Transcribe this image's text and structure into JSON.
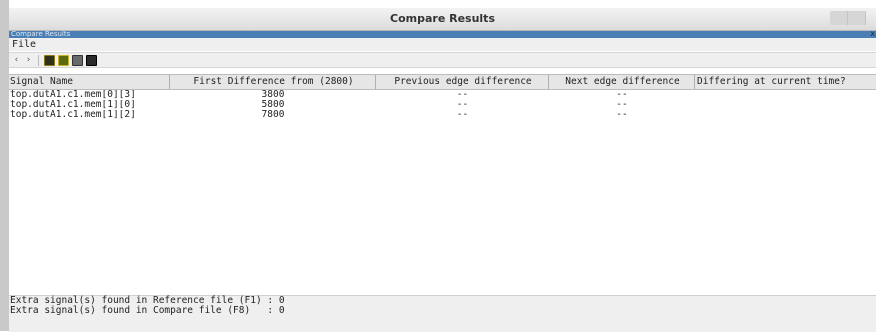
{
  "window": {
    "title": "Compare Results",
    "inner_title": "Compare Results",
    "inner_close": "x"
  },
  "menu": {
    "file": "File"
  },
  "toolbar": {
    "back": "‹",
    "forward": "›",
    "icons": [
      "signal-icon",
      "compare-icon",
      "print-icon",
      "save-icon"
    ]
  },
  "table": {
    "columns": [
      "Signal Name",
      "First Difference from (2800)",
      "Previous edge difference",
      "Next edge difference",
      "Differing at current time?"
    ],
    "rows": [
      {
        "name": "top.dutA1.c1.mem[0][3]",
        "first": "3800",
        "prev": "--",
        "next": "--",
        "diff": ""
      },
      {
        "name": "top.dutA1.c1.mem[1][0]",
        "first": "5800",
        "prev": "--",
        "next": "--",
        "diff": ""
      },
      {
        "name": "top.dutA1.c1.mem[1][2]",
        "first": "7800",
        "prev": "--",
        "next": "--",
        "diff": ""
      }
    ]
  },
  "footer": {
    "line1": "Extra signal(s) found in Reference file (F1) : 0",
    "line2": "Extra signal(s) found in Compare file (F8)   : 0"
  },
  "colors": {
    "accent": "#4a7fb5"
  }
}
